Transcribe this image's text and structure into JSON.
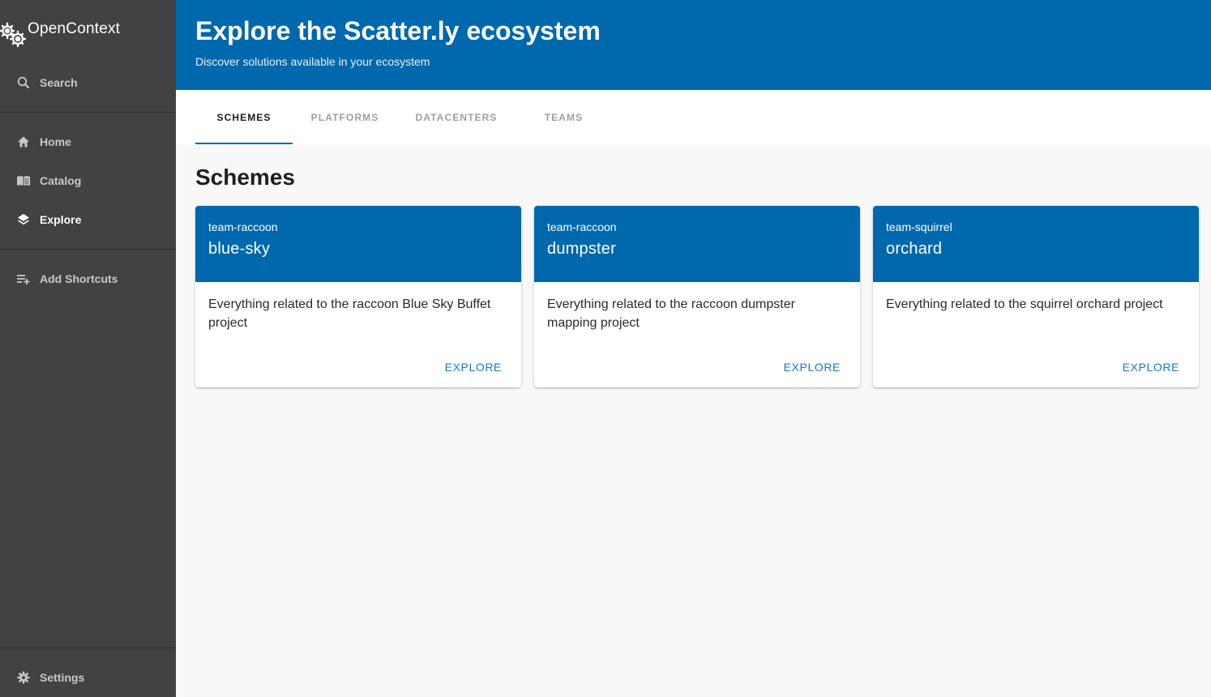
{
  "app": {
    "logo_text": "OpenContext"
  },
  "sidebar": {
    "search_label": "Search",
    "items": [
      {
        "label": "Home",
        "icon": "home-icon"
      },
      {
        "label": "Catalog",
        "icon": "catalog-icon"
      },
      {
        "label": "Explore",
        "icon": "layers-icon",
        "active": true
      }
    ],
    "shortcuts_label": "Add Shortcuts",
    "settings_label": "Settings"
  },
  "header": {
    "title": "Explore the Scatter.ly ecosystem",
    "subtitle": "Discover solutions available in your ecosystem"
  },
  "tabs": [
    {
      "label": "SCHEMES",
      "active": true
    },
    {
      "label": "PLATFORMS"
    },
    {
      "label": "DATACENTERS"
    },
    {
      "label": "TEAMS"
    }
  ],
  "section": {
    "title": "Schemes"
  },
  "cards": [
    {
      "team": "team-raccoon",
      "name": "blue-sky",
      "description": "Everything related to the raccoon Blue Sky Buffet project",
      "action": "EXPLORE"
    },
    {
      "team": "team-raccoon",
      "name": "dumpster",
      "description": "Everything related to the raccoon dumpster mapping project",
      "action": "EXPLORE"
    },
    {
      "team": "team-squirrel",
      "name": "orchard",
      "description": "Everything related to the squirrel orchard project",
      "action": "EXPLORE"
    }
  ],
  "colors": {
    "brand": "#0068ad",
    "sidebar": "#424242",
    "link": "#1f74c4"
  }
}
